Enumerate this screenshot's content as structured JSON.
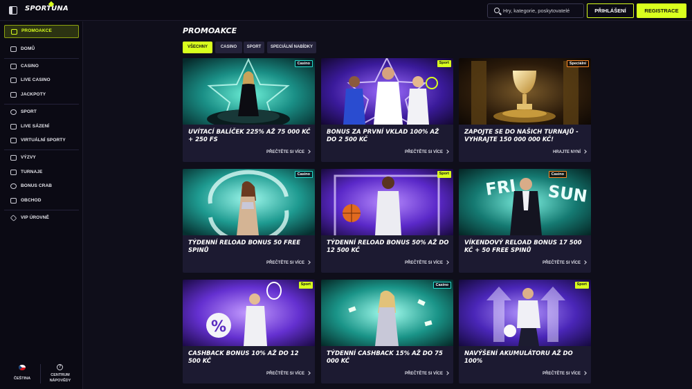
{
  "header": {
    "logo_text": "SPORTUNA",
    "search": {
      "placeholder": "Hry, kategorie, poskytovatelé"
    },
    "login_label": "PŘIHLÁŠENÍ",
    "register_label": "REGISTRACE"
  },
  "sidebar": {
    "items": [
      {
        "label": "PROMOAKCE",
        "icon": "gift-icon",
        "active": true
      },
      {
        "label": "DOMŮ",
        "icon": "home-icon"
      },
      {
        "label": "CASINO",
        "icon": "cards-icon"
      },
      {
        "label": "LIVE CASINO",
        "icon": "live-cards-icon"
      },
      {
        "label": "JACKPOTY",
        "icon": "jackpot-icon"
      },
      {
        "label": "SPORT",
        "icon": "ball-icon"
      },
      {
        "label": "LIVE SÁZENÍ",
        "icon": "live-icon"
      },
      {
        "label": "VIRTUÁLNÍ SPORTY",
        "icon": "gamepad-icon"
      },
      {
        "label": "VÝZVY",
        "icon": "trophy-icon"
      },
      {
        "label": "TURNAJE",
        "icon": "tournament-icon"
      },
      {
        "label": "BONUS CRAB",
        "icon": "crab-icon"
      },
      {
        "label": "OBCHOD",
        "icon": "shop-icon"
      },
      {
        "label": "VIP ÚROVNĚ",
        "icon": "diamond-icon"
      }
    ],
    "language_label": "ČEŠTINA",
    "help_label_1": "CENTRUM",
    "help_label_2": "NÁPOVĚDY"
  },
  "main": {
    "title": "PROMOAKCE",
    "tabs": [
      {
        "label": "VŠECHNY",
        "active": true
      },
      {
        "label": "CASINO"
      },
      {
        "label": "SPORT"
      },
      {
        "label": "SPECIÁLNÍ NABÍDKY"
      }
    ],
    "cards": [
      {
        "badge": "Casino",
        "title": "UVÍTACÍ BALÍČEK 225% AŽ 75 000 KČ + 250 FS",
        "link": "PŘEČTĚTE SI VÍCE"
      },
      {
        "badge": "Sport",
        "title": "BONUS ZA PRVNÍ VKLAD 100% AŽ DO 2 500 KČ",
        "link": "PŘEČTĚTE SI VÍCE"
      },
      {
        "badge": "Speciální",
        "title": "ZAPOJTE SE DO NAŠICH TURNAJŮ - VYHRAJTE 150 000 000 KČ!",
        "link": "HRAJTE NYNÍ"
      },
      {
        "badge": "Casino",
        "title": "TÝDENNÍ RELOAD BONUS 50 FREE SPINŮ",
        "link": "PŘEČTĚTE SI VÍCE"
      },
      {
        "badge": "Sport",
        "title": "TÝDENNÍ RELOAD BONUS 50% AŽ DO 12 500 KČ",
        "link": "PŘEČTĚTE SI VÍCE"
      },
      {
        "badge": "Casino",
        "title": "VÍKENDOVÝ RELOAD BONUS 17 500 KČ + 50 FREE SPINŮ",
        "link": "PŘEČTĚTE SI VÍCE",
        "art_text_1": "FRI",
        "art_text_2": "SUN"
      },
      {
        "badge": "Sport",
        "title": "CASHBACK BONUS 10% AŽ DO 12 500 KČ",
        "link": "PŘEČTĚTE SI VÍCE",
        "art_text_1": "%"
      },
      {
        "badge": "Casino",
        "title": "TÝDENNÍ CASHBACK 15% AŽ DO 75 000 KČ",
        "link": "PŘEČTĚTE SI VÍCE"
      },
      {
        "badge": "Sport",
        "title": "NAVÝŠENÍ AKUMULÁTORU AŽ DO 100%",
        "link": "PŘEČTĚTE SI VÍCE"
      }
    ]
  },
  "colors": {
    "accent": "#d9ff1e",
    "background": "#0f0e1a",
    "card": "#1c1a31",
    "casino_badge": "#27e0d0",
    "special_badge": "#ff8a2a"
  }
}
